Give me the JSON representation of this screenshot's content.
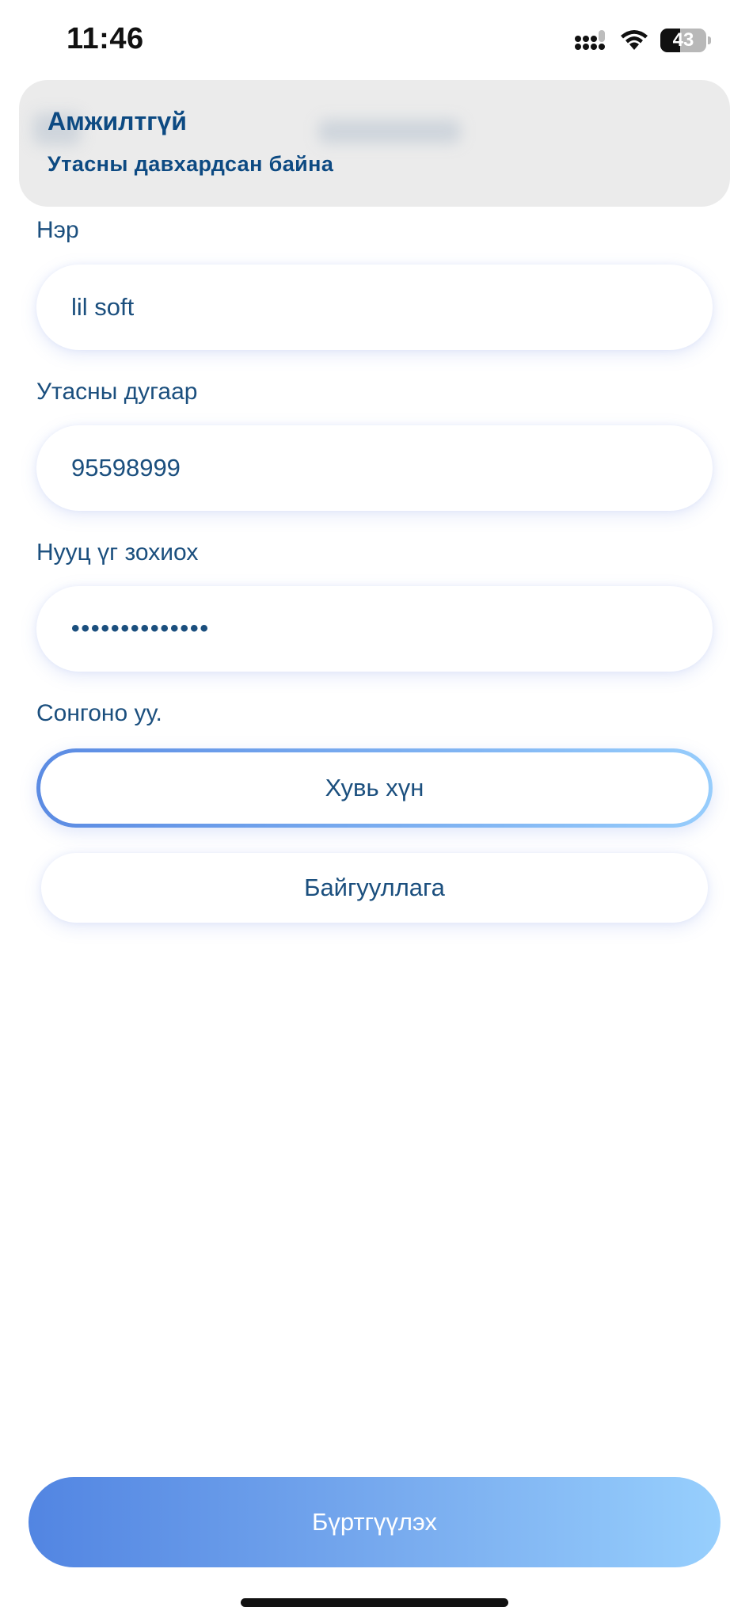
{
  "status_bar": {
    "time": "11:46",
    "battery_percent": "43"
  },
  "toast": {
    "title": "Амжилтгүй",
    "message": "Утасны давхардсан байна"
  },
  "form": {
    "name_label": "Нэр",
    "name_value": "lil soft",
    "phone_label": "Утасны дугаар",
    "phone_value": "95598999",
    "password_label": "Нууц үг зохиох",
    "password_value": "••••••••••••••",
    "choose_label": "Сонгоно уу.",
    "options": [
      {
        "label": "Хувь хүн",
        "selected": true
      },
      {
        "label": "Байгууллага",
        "selected": false
      }
    ]
  },
  "register_button": "Бүртгүүлэх",
  "colors": {
    "text": "#0d4a82",
    "accent_start": "#5285e2",
    "accent_end": "#97cffd",
    "toast_bg": "#ebebeb"
  }
}
